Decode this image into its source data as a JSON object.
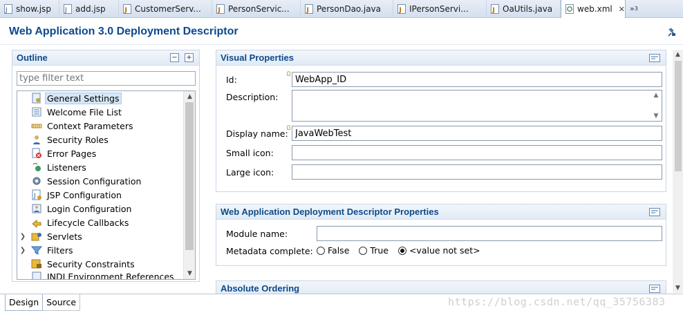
{
  "tabs": [
    {
      "label": "show.jsp",
      "icon": "jsp-file-icon"
    },
    {
      "label": "add.jsp",
      "icon": "jsp-file-icon"
    },
    {
      "label": "CustomerServ...",
      "icon": "java-file-icon"
    },
    {
      "label": "PersonServic...",
      "icon": "java-file-icon"
    },
    {
      "label": "PersonDao.java",
      "icon": "java-file-icon"
    },
    {
      "label": "IPersonServi...",
      "icon": "java-file-icon"
    },
    {
      "label": "OaUtils.java",
      "icon": "java-file-icon"
    },
    {
      "label": "web.xml",
      "icon": "xml-file-icon",
      "active": true
    }
  ],
  "tab_overflow": "»",
  "tab_overflow_count": "3",
  "tab_close": "✕",
  "editor": {
    "title": "Web Application 3.0 Deployment Descriptor"
  },
  "outline": {
    "title": "Outline",
    "collapse_label": "−",
    "expand_label": "+",
    "filter_placeholder": "type filter text",
    "items": [
      {
        "label": "General Settings",
        "selected": true
      },
      {
        "label": "Welcome File List"
      },
      {
        "label": "Context Parameters"
      },
      {
        "label": "Security Roles"
      },
      {
        "label": "Error Pages"
      },
      {
        "label": "Listeners"
      },
      {
        "label": "Session Configuration"
      },
      {
        "label": "JSP Configuration"
      },
      {
        "label": "Login Configuration"
      },
      {
        "label": "Lifecycle Callbacks"
      },
      {
        "label": "Servlets",
        "expandable": true
      },
      {
        "label": "Filters",
        "expandable": true
      },
      {
        "label": "Security Constraints"
      },
      {
        "label": "JNDI Environment References"
      }
    ]
  },
  "visual_properties": {
    "title": "Visual Properties",
    "id_label": "Id:",
    "id_value": "WebApp_ID",
    "description_label": "Description:",
    "display_name_label": "Display name:",
    "display_name_value": "JavaWebTest",
    "small_icon_label": "Small icon:",
    "large_icon_label": "Large icon:"
  },
  "dd_properties": {
    "title": "Web Application Deployment Descriptor Properties",
    "module_name_label": "Module name:",
    "metadata_label": "Metadata complete:",
    "options": [
      "False",
      "True",
      "<value not set>"
    ],
    "selected": "<value not set>"
  },
  "absolute_ordering": {
    "title": "Absolute Ordering"
  },
  "bottom_tabs": [
    "Design",
    "Source"
  ],
  "watermark": "https://blog.csdn.net/qq_35756383"
}
